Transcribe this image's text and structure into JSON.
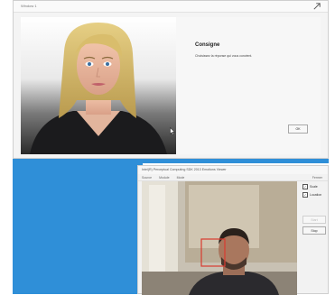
{
  "window1": {
    "title": "Window 1",
    "heading": "Consigne",
    "instruction": "Choisissez la réponse qui vous convient.",
    "ok_label": "OK"
  },
  "window2": {
    "title": "Intel(R) Perceptual Computing SDK 2013 Emotions Viewer",
    "close_label": "Fermer",
    "menu": [
      "Source",
      "Module",
      "Mode"
    ],
    "options": [
      {
        "label": "Scale",
        "checked": true
      },
      {
        "label": "Location",
        "checked": true
      }
    ],
    "start_label": "Start",
    "stop_label": "Stop"
  },
  "colors": {
    "desktop_blue": "#2f8fd8",
    "detection_box": "#d93a2f"
  },
  "icons": [
    "expand-icon",
    "mouse-cursor-icon"
  ]
}
